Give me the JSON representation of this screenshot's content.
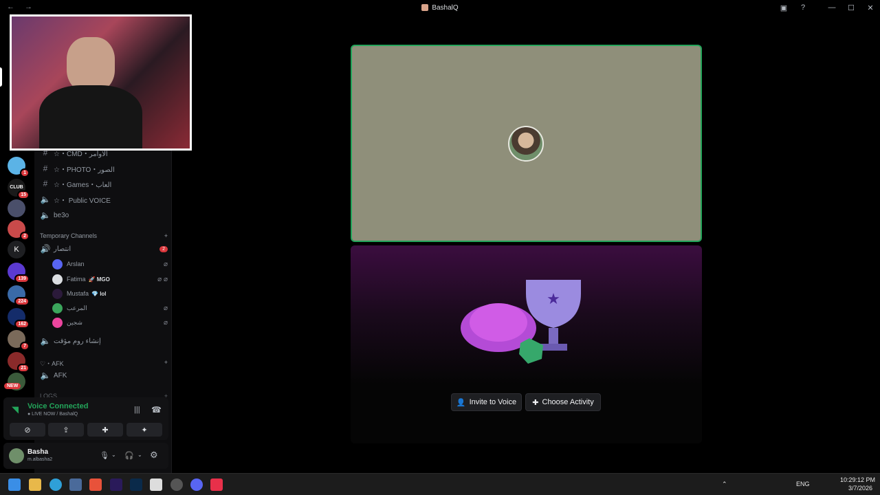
{
  "window": {
    "title": "BashalQ",
    "nav": "← →"
  },
  "titlebar_icons": [
    "screen-icon",
    "help-icon",
    "minimize-icon",
    "maximize-icon",
    "close-icon"
  ],
  "servers": [
    {
      "badge": "1"
    },
    {
      "label": "CLUB",
      "badge": "15"
    },
    {
      "badge": ""
    },
    {
      "badge": "2"
    },
    {
      "label": "K",
      "badge": ""
    },
    {
      "badge": "139"
    },
    {
      "badge": "224"
    },
    {
      "badge": "162"
    },
    {
      "badge": "7"
    },
    {
      "badge": "21"
    },
    {
      "label": "NEW"
    }
  ],
  "channels": [
    {
      "name": "☆・CMD・الاوامر",
      "type": "text"
    },
    {
      "name": "☆・PHOTO・الصور",
      "type": "text"
    },
    {
      "name": "☆・Games・العاب",
      "type": "text"
    },
    {
      "name": "☆・ Public VOICE",
      "type": "voice"
    },
    {
      "name": "be3o",
      "type": "voice"
    }
  ],
  "temp_category": {
    "label": "Temporary Channels",
    "plus": "+"
  },
  "temp_channel": {
    "name": "انتصار",
    "badge": "2"
  },
  "voice_users": [
    {
      "name": "Arslan",
      "tag": "",
      "color": "#5865f2"
    },
    {
      "name": "Fatima",
      "tag": "🚀 MGO",
      "color": "#dbdee1"
    },
    {
      "name": "Mustafa",
      "tag": "💎 lol",
      "color": "#2b1a3a"
    },
    {
      "name": "المرعب",
      "tag": "",
      "color": "#3ba55c"
    },
    {
      "name": "شجين",
      "tag": "",
      "color": "#eb459e"
    }
  ],
  "create_room": "إنشاء روم مؤقت",
  "afk_category": "♡・AFK",
  "afk_channel": "AFK",
  "logs_category": "LOGS",
  "voice_panel": {
    "status": "Voice Connected",
    "sub": "● LIVE NOW / BashalQ"
  },
  "user_panel": {
    "name": "Basha",
    "sub": "m.albasha2"
  },
  "activity": {
    "invite": "Invite to Voice",
    "choose": "Choose Activity"
  },
  "tray": {
    "lang": "ENG",
    "time": "10:29:12 PM",
    "date": "3/7/2026"
  },
  "colors": {
    "connected": "#23a55a",
    "badge": "#da373c",
    "tile": "#8f8f7a"
  }
}
